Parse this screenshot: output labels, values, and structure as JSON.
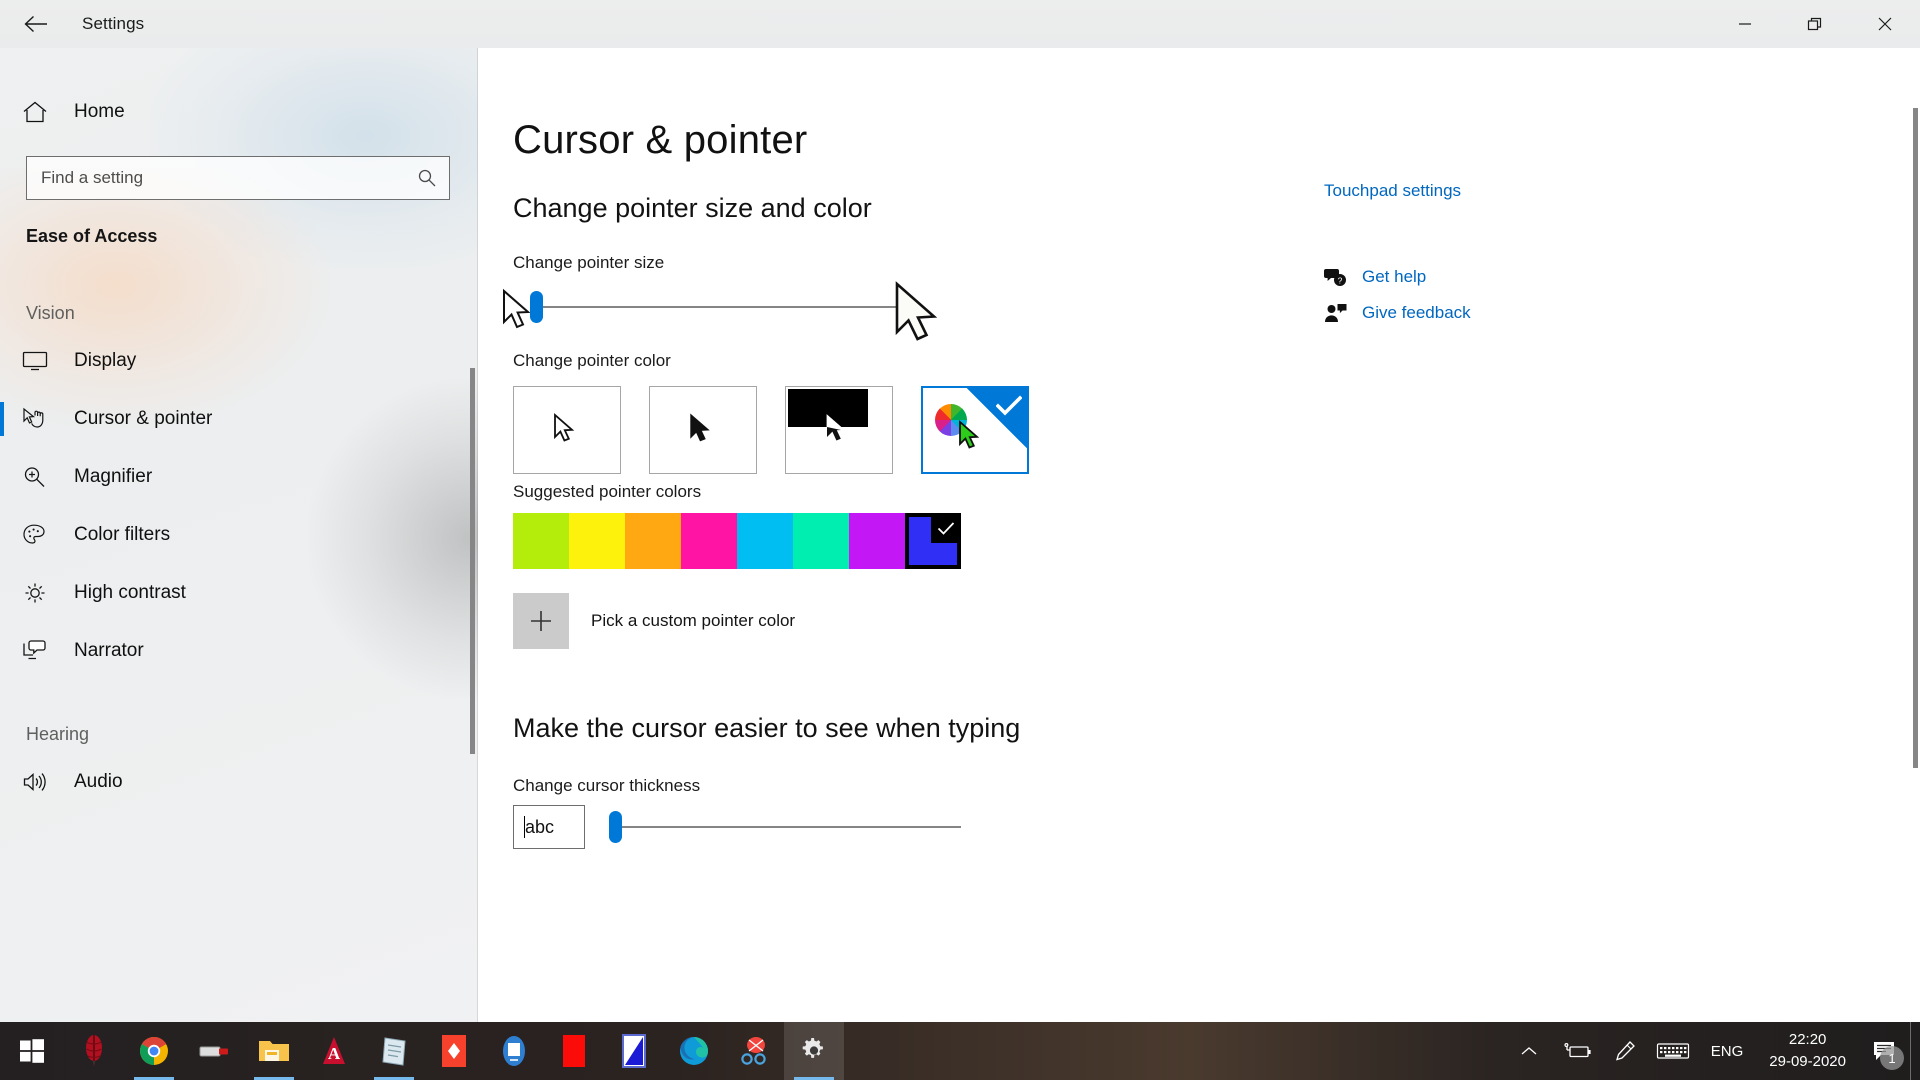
{
  "window": {
    "title": "Settings",
    "back_icon": "back-arrow-icon",
    "minimize_label": "Minimize",
    "restore_label": "Restore",
    "close_label": "Close"
  },
  "sidebar": {
    "home_label": "Home",
    "home_icon": "home-icon",
    "search": {
      "placeholder": "Find a setting",
      "value": "",
      "icon": "search-icon"
    },
    "category": "Ease of Access",
    "groups": [
      {
        "header": "Vision",
        "items": [
          {
            "label": "Display",
            "icon": "monitor-icon",
            "selected": false
          },
          {
            "label": "Cursor & pointer",
            "icon": "cursor-hand-icon",
            "selected": true
          },
          {
            "label": "Magnifier",
            "icon": "magnifier-icon",
            "selected": false
          },
          {
            "label": "Color filters",
            "icon": "palette-icon",
            "selected": false
          },
          {
            "label": "High contrast",
            "icon": "sun-icon",
            "selected": false
          },
          {
            "label": "Narrator",
            "icon": "narrator-icon",
            "selected": false
          }
        ]
      },
      {
        "header": "Hearing",
        "items": [
          {
            "label": "Audio",
            "icon": "speaker-icon",
            "selected": false
          }
        ]
      }
    ]
  },
  "main": {
    "page_title": "Cursor & pointer",
    "section_size_color": "Change pointer size and color",
    "pointer_size_label": "Change pointer size",
    "pointer_size_value": 1,
    "pointer_color_label": "Change pointer color",
    "pointer_color_options": [
      {
        "name": "white-pointer",
        "selected": false
      },
      {
        "name": "black-pointer",
        "selected": false
      },
      {
        "name": "inverted-pointer",
        "selected": false
      },
      {
        "name": "custom-color-pointer",
        "selected": true
      }
    ],
    "suggested_label": "Suggested pointer colors",
    "suggested_colors": [
      {
        "hex": "#b4ec0c",
        "selected": false
      },
      {
        "hex": "#fdf20b",
        "selected": false
      },
      {
        "hex": "#ffa811",
        "selected": false
      },
      {
        "hex": "#ff14a4",
        "selected": false
      },
      {
        "hex": "#00bdf2",
        "selected": false
      },
      {
        "hex": "#00efb0",
        "selected": false
      },
      {
        "hex": "#c318f5",
        "selected": false
      },
      {
        "hex": "#2f2ff5",
        "selected": true
      }
    ],
    "custom_color_label": "Pick a custom pointer color",
    "custom_color_icon": "plus-icon",
    "section_cursor_typing": "Make the cursor easier to see when typing",
    "cursor_thickness_label": "Change cursor thickness",
    "cursor_preview_text": "abc",
    "cursor_thickness_value": 1
  },
  "right_rail": {
    "touchpad_link": "Touchpad settings",
    "links": [
      {
        "label": "Get help",
        "icon": "help-bubble-icon"
      },
      {
        "label": "Give feedback",
        "icon": "feedback-person-icon"
      }
    ]
  },
  "taskbar": {
    "start_icon": "windows-start-icon",
    "apps": [
      {
        "name": "feather-app-icon",
        "active": false,
        "running": false
      },
      {
        "name": "google-chrome-icon",
        "active": false,
        "running": true
      },
      {
        "name": "usb-drive-icon",
        "active": false,
        "running": false
      },
      {
        "name": "file-explorer-icon",
        "active": false,
        "running": true
      },
      {
        "name": "adobe-acrobat-icon",
        "active": false,
        "running": false
      },
      {
        "name": "notepad-icon",
        "active": false,
        "running": true
      },
      {
        "name": "red-diamond-app-icon",
        "active": false,
        "running": false
      },
      {
        "name": "blue-monitor-app-icon",
        "active": false,
        "running": false
      },
      {
        "name": "red-block-app-icon",
        "active": false,
        "running": false
      },
      {
        "name": "blue-gradient-app-icon",
        "active": false,
        "running": false
      },
      {
        "name": "microsoft-edge-icon",
        "active": false,
        "running": false
      },
      {
        "name": "snipping-tool-icon",
        "active": false,
        "running": false
      },
      {
        "name": "settings-gear-icon",
        "active": true,
        "running": true
      }
    ],
    "tray": {
      "chevron_icon": "show-hidden-icons-chevron",
      "battery_icon": "battery-charging-icon",
      "pen_icon": "pen-workspace-icon",
      "keyboard_icon": "touch-keyboard-icon",
      "language": "ENG",
      "time": "22:20",
      "date": "29-09-2020",
      "notification_icon": "action-center-icon",
      "notification_count": "1"
    }
  },
  "colors": {
    "accent": "#0078d7",
    "link": "#0067c0",
    "selected_swatch": "#2f2ff5"
  }
}
